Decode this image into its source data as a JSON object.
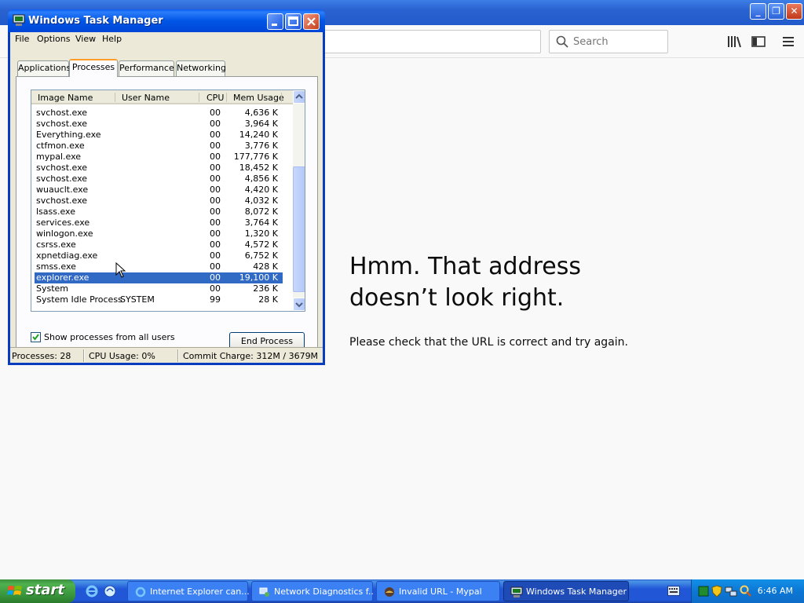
{
  "browser": {
    "search_placeholder": "Search",
    "error_title_line1": "Hmm. That address",
    "error_title_line2": "doesn’t look right.",
    "error_body": "Please check that the URL is correct and try again."
  },
  "taskmanager": {
    "title": "Windows Task Manager",
    "menu": [
      "File",
      "Options",
      "View",
      "Help"
    ],
    "tabs": [
      "Applications",
      "Processes",
      "Performance",
      "Networking"
    ],
    "active_tab": "Processes",
    "columns": [
      "Image Name",
      "User Name",
      "CPU",
      "Mem Usage"
    ],
    "processes": [
      {
        "name": "svchost.exe",
        "user": "",
        "cpu": "00",
        "mem": "4,636 K"
      },
      {
        "name": "svchost.exe",
        "user": "",
        "cpu": "00",
        "mem": "3,964 K"
      },
      {
        "name": "Everything.exe",
        "user": "",
        "cpu": "00",
        "mem": "14,240 K"
      },
      {
        "name": "ctfmon.exe",
        "user": "",
        "cpu": "00",
        "mem": "3,776 K"
      },
      {
        "name": "mypal.exe",
        "user": "",
        "cpu": "00",
        "mem": "177,776 K"
      },
      {
        "name": "svchost.exe",
        "user": "",
        "cpu": "00",
        "mem": "18,452 K"
      },
      {
        "name": "svchost.exe",
        "user": "",
        "cpu": "00",
        "mem": "4,856 K"
      },
      {
        "name": "wuauclt.exe",
        "user": "",
        "cpu": "00",
        "mem": "4,420 K"
      },
      {
        "name": "svchost.exe",
        "user": "",
        "cpu": "00",
        "mem": "4,032 K"
      },
      {
        "name": "lsass.exe",
        "user": "",
        "cpu": "00",
        "mem": "8,072 K"
      },
      {
        "name": "services.exe",
        "user": "",
        "cpu": "00",
        "mem": "3,764 K"
      },
      {
        "name": "winlogon.exe",
        "user": "",
        "cpu": "00",
        "mem": "1,320 K"
      },
      {
        "name": "csrss.exe",
        "user": "",
        "cpu": "00",
        "mem": "4,572 K"
      },
      {
        "name": "xpnetdiag.exe",
        "user": "",
        "cpu": "00",
        "mem": "6,752 K"
      },
      {
        "name": "smss.exe",
        "user": "",
        "cpu": "00",
        "mem": "428 K"
      },
      {
        "name": "explorer.exe",
        "user": "",
        "cpu": "00",
        "mem": "19,100 K"
      },
      {
        "name": "System",
        "user": "",
        "cpu": "00",
        "mem": "236 K"
      },
      {
        "name": "System Idle Process",
        "user": "SYSTEM",
        "cpu": "99",
        "mem": "28 K"
      }
    ],
    "selected_process": "explorer.exe",
    "show_all_label": "Show processes from all users",
    "show_all_checked": true,
    "end_process_label": "End Process",
    "status": {
      "processes": "Processes: 28",
      "cpu": "CPU Usage: 0%",
      "commit": "Commit Charge: 312M / 3679M"
    }
  },
  "taskbar": {
    "start_label": "start",
    "tasks": [
      {
        "label": "Internet Explorer can...",
        "icon": "ie-icon"
      },
      {
        "label": "Network Diagnostics f...",
        "icon": "network-diagnostics-icon"
      },
      {
        "label": "Invalid URL - Mypal",
        "icon": "mypal-icon"
      },
      {
        "label": "Windows Task Manager",
        "icon": "taskmanager-icon"
      }
    ],
    "clock": "6:46 AM"
  }
}
